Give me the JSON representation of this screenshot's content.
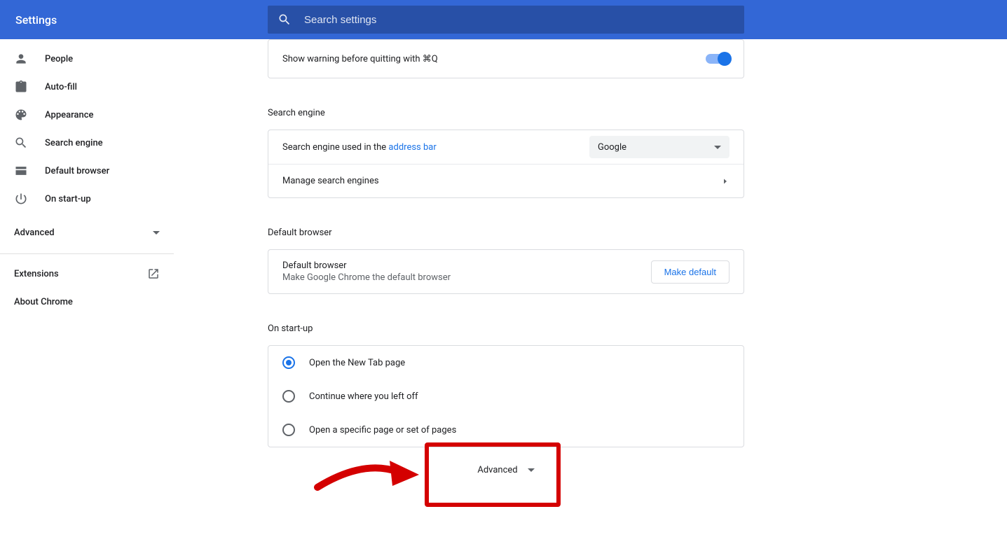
{
  "header": {
    "title": "Settings",
    "search_placeholder": "Search settings"
  },
  "sidebar": {
    "items": [
      {
        "label": "People"
      },
      {
        "label": "Auto-fill"
      },
      {
        "label": "Appearance"
      },
      {
        "label": "Search engine"
      },
      {
        "label": "Default browser"
      },
      {
        "label": "On start-up"
      }
    ],
    "advanced_label": "Advanced",
    "extensions_label": "Extensions",
    "about_label": "About Chrome"
  },
  "quit_warning": {
    "label": "Show warning before quitting with ⌘Q",
    "enabled": true
  },
  "search_engine_section": {
    "title": "Search engine",
    "used_in_prefix": "Search engine used in the ",
    "address_bar_link": "address bar",
    "selected": "Google",
    "manage_label": "Manage search engines"
  },
  "default_browser_section": {
    "title": "Default browser",
    "row_title": "Default browser",
    "subtext": "Make Google Chrome the default browser",
    "button_label": "Make default"
  },
  "startup_section": {
    "title": "On start-up",
    "options": [
      "Open the New Tab page",
      "Continue where you left off",
      "Open a specific page or set of pages"
    ],
    "selected_index": 0
  },
  "footer": {
    "advanced_label": "Advanced"
  }
}
